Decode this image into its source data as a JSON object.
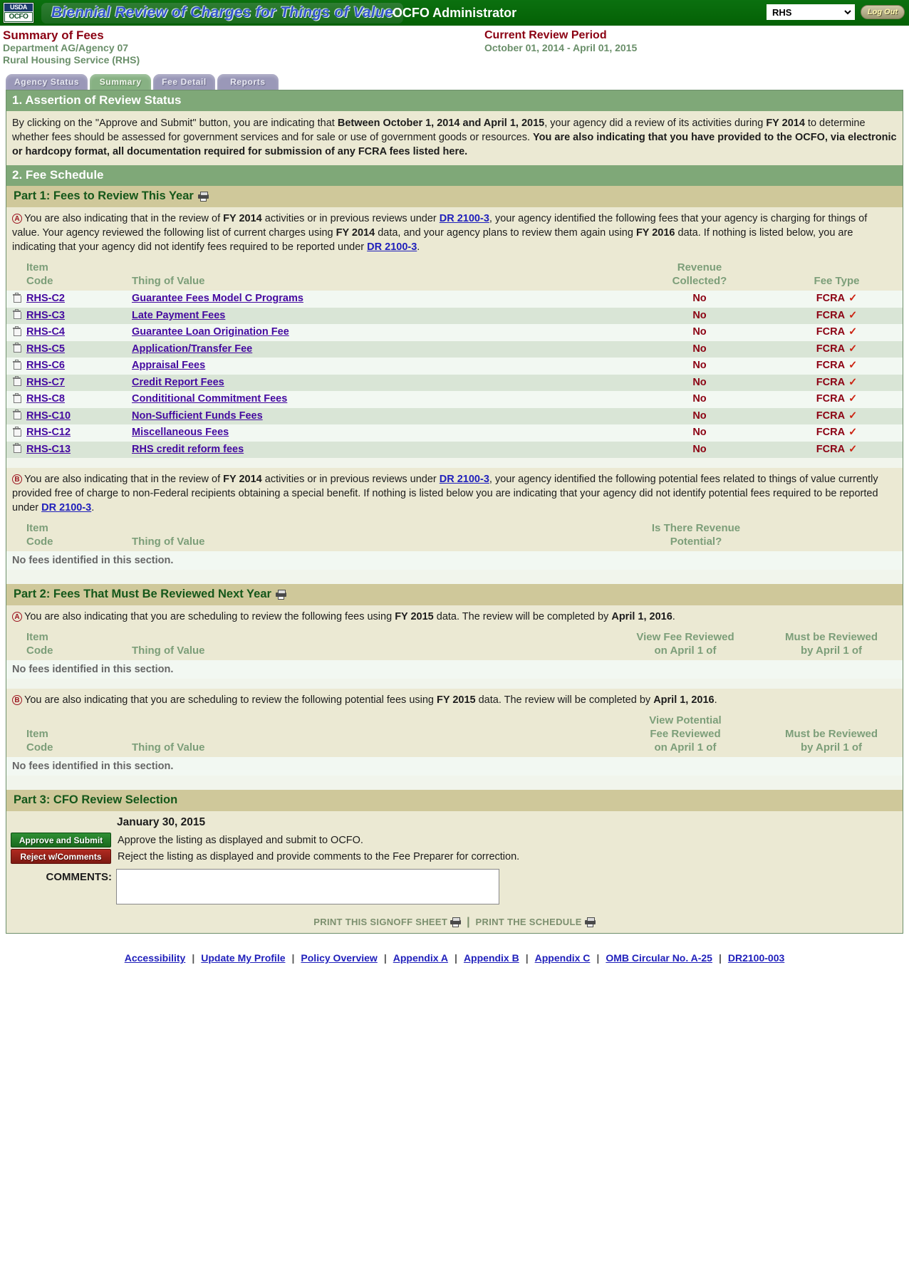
{
  "topbar": {
    "logo_line1": "USDA",
    "logo_line2": "OCFO",
    "app_title": "Biennial Review of Charges for Things of Value",
    "role_title": "OCFO Administrator",
    "agency_selected": "RHS",
    "agency_options": [
      "RHS"
    ],
    "logout_label": "Log Out"
  },
  "subhead": {
    "title": "Summary of Fees",
    "department": "Department AG/Agency 07",
    "agency": "Rural Housing Service (RHS)",
    "review_period_title": "Current Review Period",
    "review_period_dates": "October 01, 2014 - April 01, 2015"
  },
  "tabs": [
    {
      "label": "Agency Status",
      "active": false
    },
    {
      "label": "Summary",
      "active": true
    },
    {
      "label": "Fee Detail",
      "active": false
    },
    {
      "label": "Reports",
      "active": false
    }
  ],
  "section1": {
    "heading": "1. Assertion of Review Status",
    "body_p1": "By clicking on the \"Approve and Submit\" button, you are indicating that ",
    "body_b1": "Between October 1, 2014 and April 1, 2015",
    "body_p2": ", your agency did a review of its activities during ",
    "body_b2": "FY 2014",
    "body_p3": " to determine whether fees should be assessed for government services and for sale or use of government goods or resources. ",
    "body_b3": "You are also indicating that you have provided to the OCFO, via electronic or hardcopy format, all documentation required for submission of any FCRA fees listed here."
  },
  "section2": {
    "heading": "2. Fee Schedule"
  },
  "part1": {
    "heading": "Part 1: Fees to Review This Year",
    "a": {
      "letter": "A",
      "t1": "You are also indicating that in the review of ",
      "b1": "FY 2014",
      "t2": " activities or in previous reviews under ",
      "link1": "DR 2100-3",
      "t3": ", your agency identified the following fees that your agency is charging for things of value. Your agency reviewed the following list of current charges using ",
      "b2": "FY 2014",
      "t4": " data, and your agency plans to review them again using ",
      "b3": "FY 2016",
      "t5": " data. If nothing is listed below, you are indicating that your agency did not identify fees required to be reported under ",
      "link2": "DR 2100-3",
      "t6": "."
    },
    "table_headers": {
      "item": "Item",
      "code": "Code",
      "thing": "Thing of Value",
      "revenue_l1": "Revenue",
      "revenue_l2": "Collected?",
      "feetype": "Fee Type"
    },
    "rows": [
      {
        "code": "RHS-C2",
        "thing": "Guarantee Fees Model C Programs",
        "revenue": "No",
        "feetype": "FCRA",
        "check": "✓"
      },
      {
        "code": "RHS-C3",
        "thing": "Late Payment Fees",
        "revenue": "No",
        "feetype": "FCRA",
        "check": "✓"
      },
      {
        "code": "RHS-C4",
        "thing": "Guarantee Loan Origination Fee",
        "revenue": "No",
        "feetype": "FCRA",
        "check": "✓"
      },
      {
        "code": "RHS-C5",
        "thing": "Application/Transfer Fee",
        "revenue": "No",
        "feetype": "FCRA",
        "check": "✓"
      },
      {
        "code": "RHS-C6",
        "thing": "Appraisal Fees",
        "revenue": "No",
        "feetype": "FCRA",
        "check": "✓"
      },
      {
        "code": "RHS-C7",
        "thing": "Credit Report Fees",
        "revenue": "No",
        "feetype": "FCRA",
        "check": "✓"
      },
      {
        "code": "RHS-C8",
        "thing": "Condititional Commitment Fees",
        "revenue": "No",
        "feetype": "FCRA",
        "check": "✓"
      },
      {
        "code": "RHS-C10",
        "thing": "Non-Sufficient Funds Fees",
        "revenue": "No",
        "feetype": "FCRA",
        "check": "✓"
      },
      {
        "code": "RHS-C12",
        "thing": "Miscellaneous Fees",
        "revenue": "No",
        "feetype": "FCRA",
        "check": "✓"
      },
      {
        "code": "RHS-C13",
        "thing": "RHS credit reform fees",
        "revenue": "No",
        "feetype": "FCRA",
        "check": "✓"
      }
    ],
    "b": {
      "letter": "B",
      "t1": "You are also indicating that in the review of ",
      "b1": "FY 2014",
      "t2": " activities or in previous reviews under ",
      "link1": "DR 2100-3",
      "t3": ", your agency identified the following potential fees related to things of value currently provided free of charge to non-Federal recipients obtaining a special benefit. If nothing is listed below you are indicating that your agency did not identify potential fees required to be reported under ",
      "link2": "DR 2100-3",
      "t4": "."
    },
    "b_table_headers": {
      "item": "Item",
      "code": "Code",
      "thing": "Thing of Value",
      "potential_l1": "Is There Revenue",
      "potential_l2": "Potential?"
    },
    "b_empty": "No fees identified in this section."
  },
  "part2": {
    "heading": "Part 2: Fees That Must Be Reviewed Next Year",
    "a": {
      "letter": "A",
      "t1": "You are also indicating that you are scheduling to review the following fees using ",
      "b1": "FY 2015",
      "t2": " data. The review will be completed by ",
      "b2": "April 1, 2016",
      "t3": "."
    },
    "a_table_headers": {
      "item": "Item",
      "code": "Code",
      "thing": "Thing of Value",
      "view_l1": "View Fee Reviewed",
      "view_l2": "on April 1 of",
      "must_l1": "Must be Reviewed",
      "must_l2": "by April 1 of"
    },
    "a_empty": "No fees identified in this section.",
    "b": {
      "letter": "B",
      "t1": "You are also indicating that you are scheduling to review the following potential fees using ",
      "b1": "FY 2015",
      "t2": " data. The review will be completed by ",
      "b2": "April 1, 2016",
      "t3": "."
    },
    "b_table_headers": {
      "item": "Item",
      "code": "Code",
      "thing": "Thing of Value",
      "view_l1": "View Potential",
      "view_l2": "Fee Reviewed",
      "view_l3": "on April 1 of",
      "must_l1": "Must be Reviewed",
      "must_l2": "by April 1 of"
    },
    "b_empty": "No fees identified in this section."
  },
  "part3": {
    "heading": "Part 3: CFO Review Selection",
    "date": "January 30, 2015",
    "approve_label": "Approve and Submit",
    "approve_text": "Approve the listing as displayed and submit to OCFO.",
    "reject_label": "Reject w/Comments",
    "reject_text": "Reject the listing as displayed and provide comments to the Fee Preparer for correction.",
    "comments_label": "COMMENTS:",
    "comments_value": "",
    "comments_placeholder": "",
    "print_signoff": "PRINT THIS SIGNOFF SHEET",
    "print_sep": "|",
    "print_schedule": "PRINT THE SCHEDULE"
  },
  "footer": {
    "links": [
      "Accessibility",
      "Update My Profile",
      "Policy Overview",
      "Appendix A",
      "Appendix B",
      "Appendix C",
      "OMB Circular No. A-25",
      "DR2100-003"
    ],
    "separator": "|"
  }
}
